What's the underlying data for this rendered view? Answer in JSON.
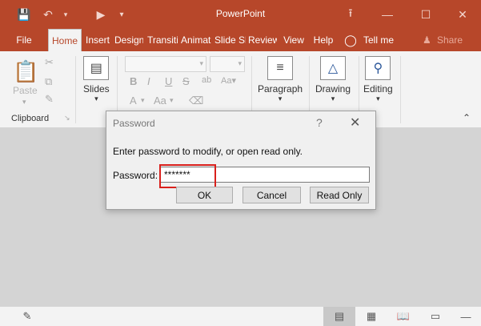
{
  "window": {
    "title": "PowerPoint"
  },
  "quick_access": {
    "save_icon": "save-icon",
    "undo_icon": "undo-icon",
    "present_icon": "present-icon"
  },
  "tabs": [
    {
      "label": "File"
    },
    {
      "label": "Home"
    },
    {
      "label": "Insert"
    },
    {
      "label": "Design"
    },
    {
      "label": "Transitions"
    },
    {
      "label": "Animations"
    },
    {
      "label": "Slide Show"
    },
    {
      "label": "Review"
    },
    {
      "label": "View"
    },
    {
      "label": "Help"
    },
    {
      "label": "Tell me"
    }
  ],
  "share_label": "Share",
  "ribbon": {
    "paste_label": "Paste",
    "clipboard_label": "Clipboard",
    "slides_label": "Slides",
    "paragraph_label": "Paragraph",
    "drawing_label": "Drawing",
    "editing_label": "Editing",
    "bold": "B",
    "italic": "I",
    "underline": "U",
    "strike": "S",
    "grow": "A",
    "aa": "Aa",
    "fontcolor": "A"
  },
  "dialog": {
    "title": "Password",
    "help": "?",
    "message": "Enter password to modify, or open read only.",
    "password_label": "Password:",
    "password_value": "*******",
    "ok_label": "OK",
    "cancel_label": "Cancel",
    "readonly_label": "Read Only"
  },
  "colors": {
    "accent": "#b7472a",
    "highlight": "#d9201c"
  }
}
